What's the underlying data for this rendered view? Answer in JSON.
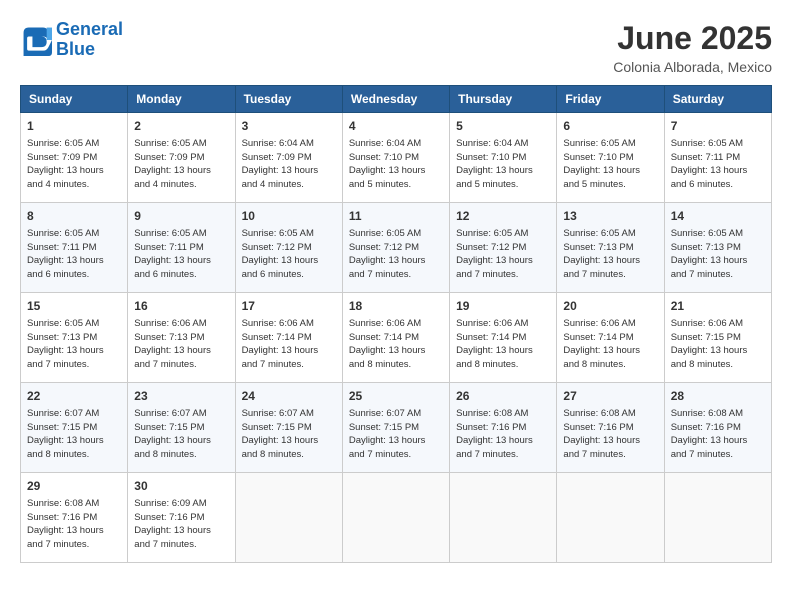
{
  "header": {
    "logo_line1": "General",
    "logo_line2": "Blue",
    "title": "June 2025",
    "subtitle": "Colonia Alborada, Mexico"
  },
  "columns": [
    "Sunday",
    "Monday",
    "Tuesday",
    "Wednesday",
    "Thursday",
    "Friday",
    "Saturday"
  ],
  "weeks": [
    [
      {
        "day": "1",
        "info": "Sunrise: 6:05 AM\nSunset: 7:09 PM\nDaylight: 13 hours\nand 4 minutes."
      },
      {
        "day": "2",
        "info": "Sunrise: 6:05 AM\nSunset: 7:09 PM\nDaylight: 13 hours\nand 4 minutes."
      },
      {
        "day": "3",
        "info": "Sunrise: 6:04 AM\nSunset: 7:09 PM\nDaylight: 13 hours\nand 4 minutes."
      },
      {
        "day": "4",
        "info": "Sunrise: 6:04 AM\nSunset: 7:10 PM\nDaylight: 13 hours\nand 5 minutes."
      },
      {
        "day": "5",
        "info": "Sunrise: 6:04 AM\nSunset: 7:10 PM\nDaylight: 13 hours\nand 5 minutes."
      },
      {
        "day": "6",
        "info": "Sunrise: 6:05 AM\nSunset: 7:10 PM\nDaylight: 13 hours\nand 5 minutes."
      },
      {
        "day": "7",
        "info": "Sunrise: 6:05 AM\nSunset: 7:11 PM\nDaylight: 13 hours\nand 6 minutes."
      }
    ],
    [
      {
        "day": "8",
        "info": "Sunrise: 6:05 AM\nSunset: 7:11 PM\nDaylight: 13 hours\nand 6 minutes."
      },
      {
        "day": "9",
        "info": "Sunrise: 6:05 AM\nSunset: 7:11 PM\nDaylight: 13 hours\nand 6 minutes."
      },
      {
        "day": "10",
        "info": "Sunrise: 6:05 AM\nSunset: 7:12 PM\nDaylight: 13 hours\nand 6 minutes."
      },
      {
        "day": "11",
        "info": "Sunrise: 6:05 AM\nSunset: 7:12 PM\nDaylight: 13 hours\nand 7 minutes."
      },
      {
        "day": "12",
        "info": "Sunrise: 6:05 AM\nSunset: 7:12 PM\nDaylight: 13 hours\nand 7 minutes."
      },
      {
        "day": "13",
        "info": "Sunrise: 6:05 AM\nSunset: 7:13 PM\nDaylight: 13 hours\nand 7 minutes."
      },
      {
        "day": "14",
        "info": "Sunrise: 6:05 AM\nSunset: 7:13 PM\nDaylight: 13 hours\nand 7 minutes."
      }
    ],
    [
      {
        "day": "15",
        "info": "Sunrise: 6:05 AM\nSunset: 7:13 PM\nDaylight: 13 hours\nand 7 minutes."
      },
      {
        "day": "16",
        "info": "Sunrise: 6:06 AM\nSunset: 7:13 PM\nDaylight: 13 hours\nand 7 minutes."
      },
      {
        "day": "17",
        "info": "Sunrise: 6:06 AM\nSunset: 7:14 PM\nDaylight: 13 hours\nand 7 minutes."
      },
      {
        "day": "18",
        "info": "Sunrise: 6:06 AM\nSunset: 7:14 PM\nDaylight: 13 hours\nand 8 minutes."
      },
      {
        "day": "19",
        "info": "Sunrise: 6:06 AM\nSunset: 7:14 PM\nDaylight: 13 hours\nand 8 minutes."
      },
      {
        "day": "20",
        "info": "Sunrise: 6:06 AM\nSunset: 7:14 PM\nDaylight: 13 hours\nand 8 minutes."
      },
      {
        "day": "21",
        "info": "Sunrise: 6:06 AM\nSunset: 7:15 PM\nDaylight: 13 hours\nand 8 minutes."
      }
    ],
    [
      {
        "day": "22",
        "info": "Sunrise: 6:07 AM\nSunset: 7:15 PM\nDaylight: 13 hours\nand 8 minutes."
      },
      {
        "day": "23",
        "info": "Sunrise: 6:07 AM\nSunset: 7:15 PM\nDaylight: 13 hours\nand 8 minutes."
      },
      {
        "day": "24",
        "info": "Sunrise: 6:07 AM\nSunset: 7:15 PM\nDaylight: 13 hours\nand 8 minutes."
      },
      {
        "day": "25",
        "info": "Sunrise: 6:07 AM\nSunset: 7:15 PM\nDaylight: 13 hours\nand 7 minutes."
      },
      {
        "day": "26",
        "info": "Sunrise: 6:08 AM\nSunset: 7:16 PM\nDaylight: 13 hours\nand 7 minutes."
      },
      {
        "day": "27",
        "info": "Sunrise: 6:08 AM\nSunset: 7:16 PM\nDaylight: 13 hours\nand 7 minutes."
      },
      {
        "day": "28",
        "info": "Sunrise: 6:08 AM\nSunset: 7:16 PM\nDaylight: 13 hours\nand 7 minutes."
      }
    ],
    [
      {
        "day": "29",
        "info": "Sunrise: 6:08 AM\nSunset: 7:16 PM\nDaylight: 13 hours\nand 7 minutes."
      },
      {
        "day": "30",
        "info": "Sunrise: 6:09 AM\nSunset: 7:16 PM\nDaylight: 13 hours\nand 7 minutes."
      },
      null,
      null,
      null,
      null,
      null
    ]
  ]
}
